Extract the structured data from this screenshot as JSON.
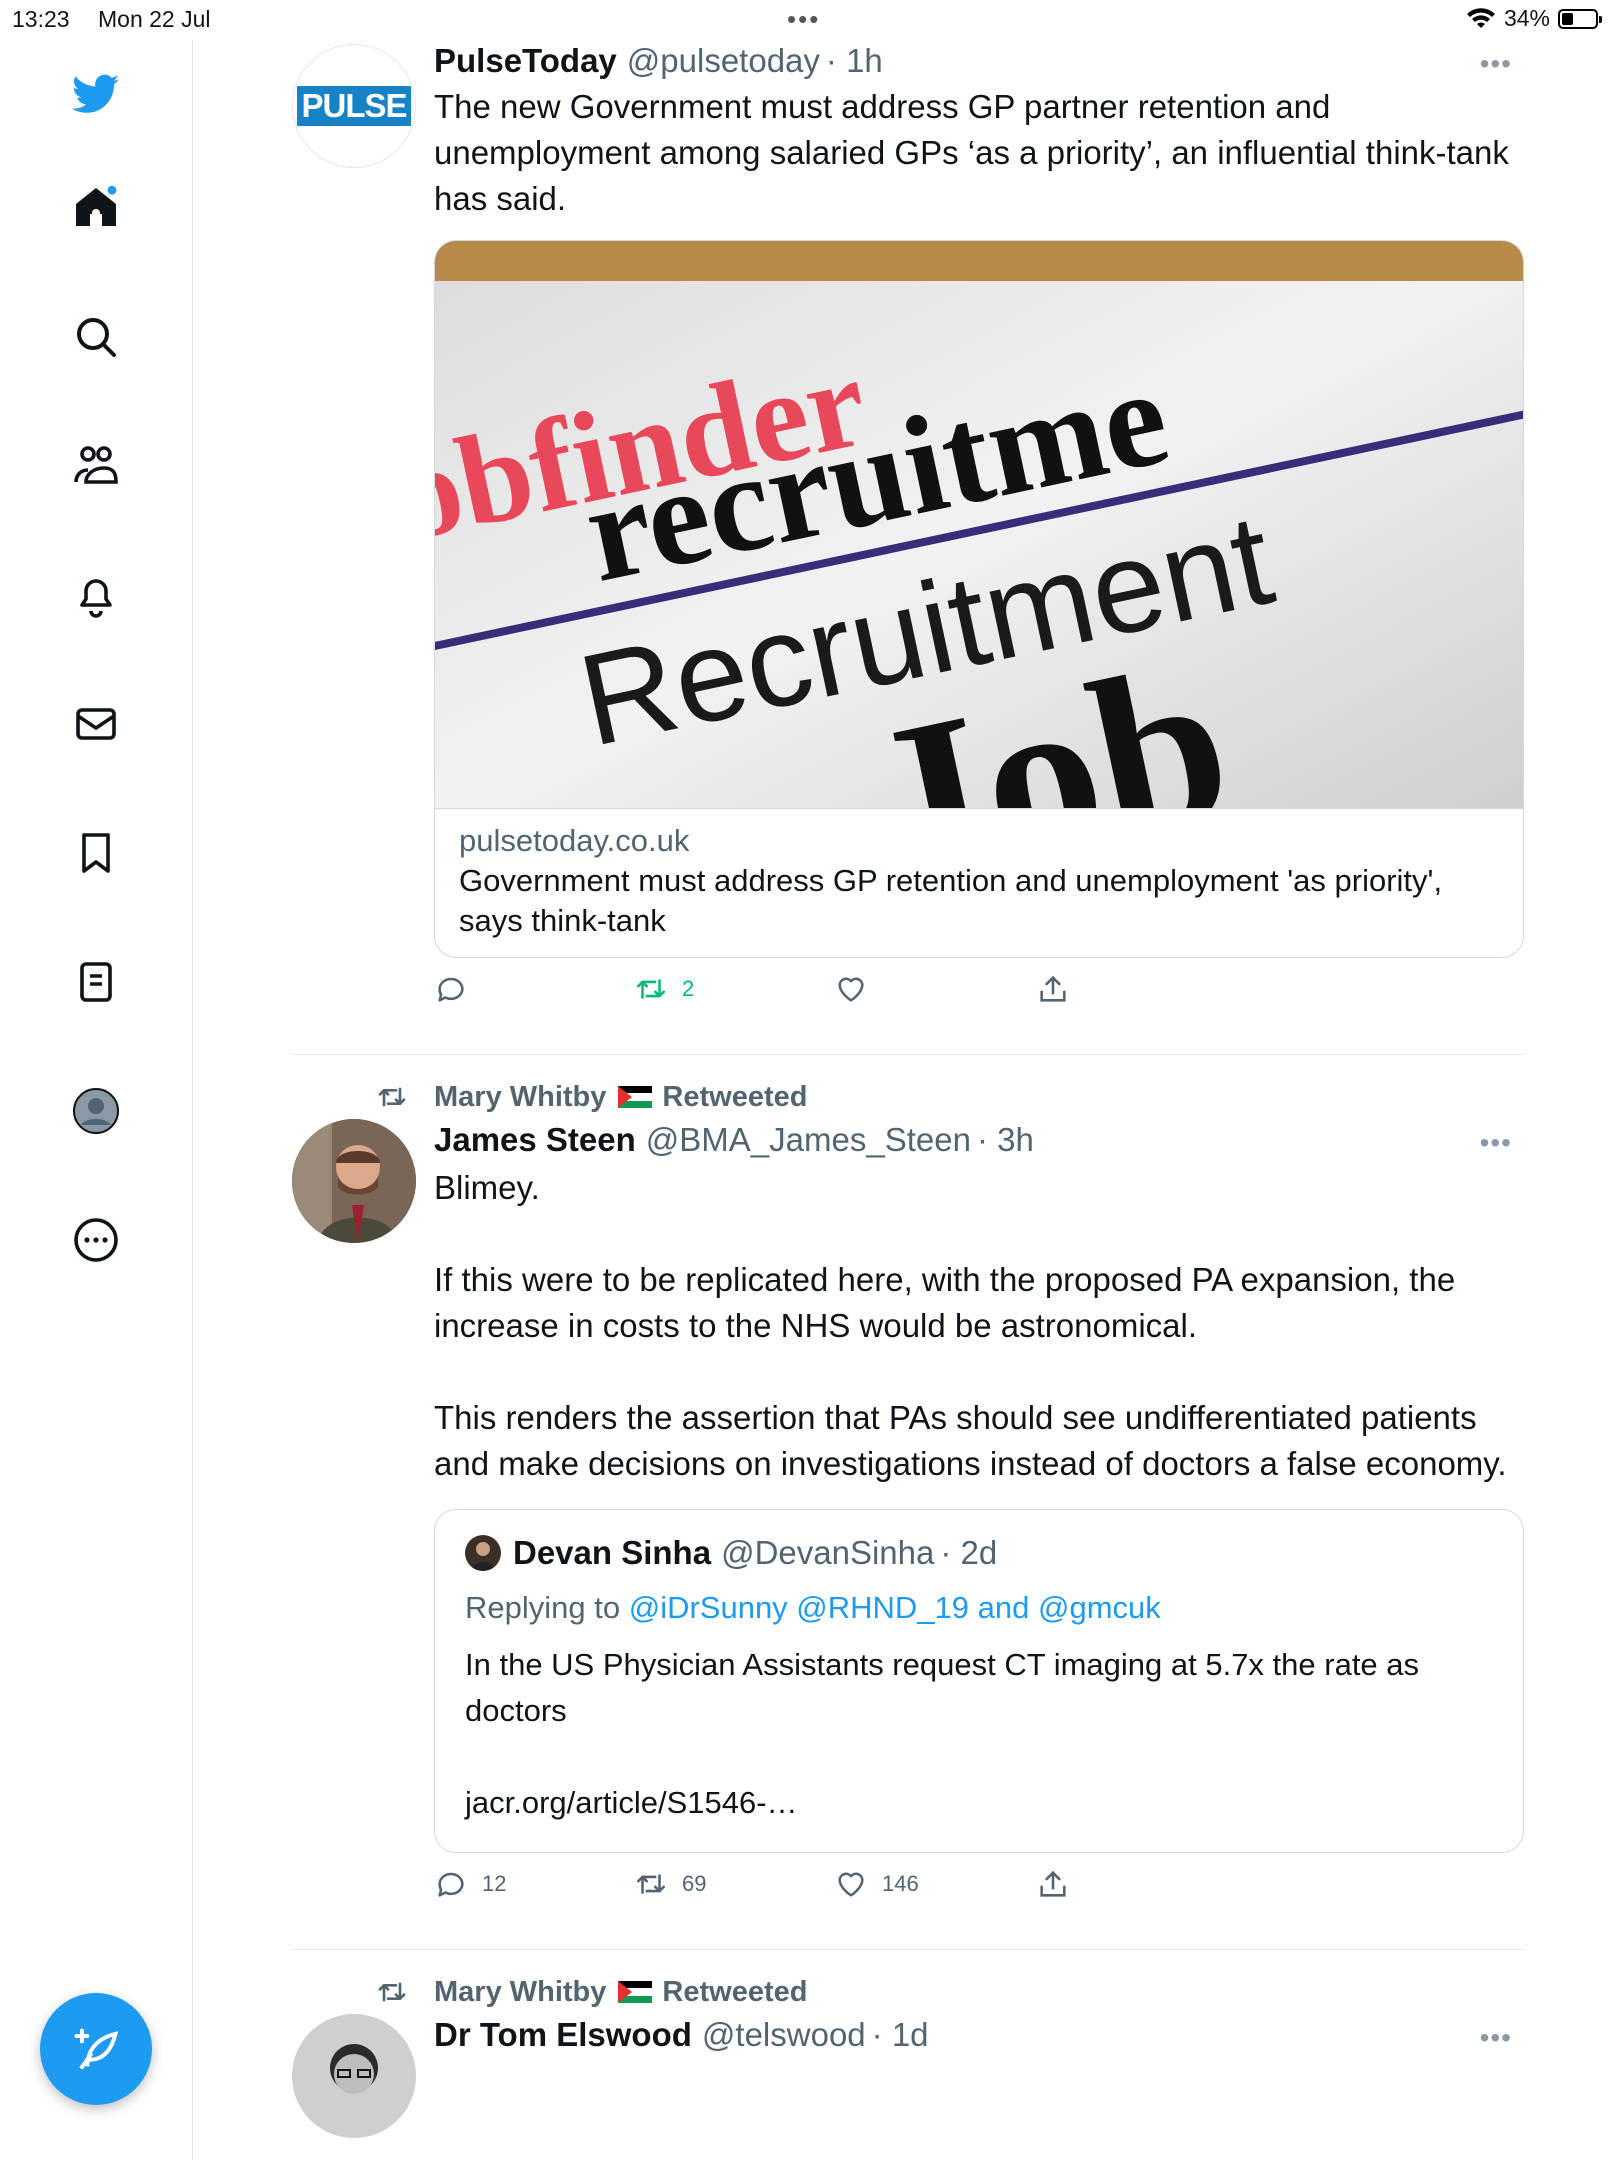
{
  "status_bar": {
    "time": "13:23",
    "date": "Mon 22 Jul",
    "battery": "34%",
    "battery_level": 0.34
  },
  "sidebar": {
    "icons": [
      "twitter-logo-icon",
      "home-icon",
      "search-icon",
      "communities-icon",
      "notifications-icon",
      "messages-icon",
      "bookmarks-icon",
      "lists-icon",
      "profile-icon",
      "more-icon"
    ],
    "compose_icon": "compose-feather-icon",
    "accent": "#1d9bf0"
  },
  "tweets": [
    {
      "name": "PulseToday",
      "handle": "@pulsetoday",
      "time": "· 1h",
      "avatar_text": "PULSE",
      "text": "The new Government must address GP partner retention and unemployment among salaried GPs ‘as a priority’, an influential think-tank has said.",
      "card": {
        "image_words": [
          "obfinder",
          "recruitme",
          "Recruitment",
          "Job"
        ],
        "domain": "pulsetoday.co.uk",
        "title": "Government must address GP retention and unemployment 'as priority', says think-tank"
      },
      "actions": {
        "reply": "",
        "retweet": "2",
        "like": "",
        "share": ""
      }
    },
    {
      "retweeted_by": "Mary Whitby",
      "retweet_label": "Retweeted",
      "name": "James Steen",
      "handle": "@BMA_James_Steen",
      "time": "· 3h",
      "text": "Blimey.\n\nIf this were to be replicated here, with the proposed PA expansion, the increase in costs to the NHS would be astronomical.\n\nThis renders the assertion that PAs should see undifferentiated patients and make decisions on investigations instead of doctors a false economy.",
      "quote": {
        "name": "Devan Sinha",
        "handle": "@DevanSinha",
        "time": "· 2d",
        "replying_prefix": "Replying to",
        "replying_mentions": "@iDrSunny @RHND_19 and @gmcuk",
        "text": "In the US Physician Assistants request CT imaging at 5.7x the rate as doctors\n\njacr.org/article/S1546-…"
      },
      "actions": {
        "reply": "12",
        "retweet": "69",
        "like": "146",
        "share": ""
      }
    },
    {
      "retweeted_by": "Mary Whitby",
      "retweet_label": "Retweeted",
      "name": "Dr Tom Elswood",
      "handle": "@telswood",
      "time": "· 1d"
    }
  ]
}
